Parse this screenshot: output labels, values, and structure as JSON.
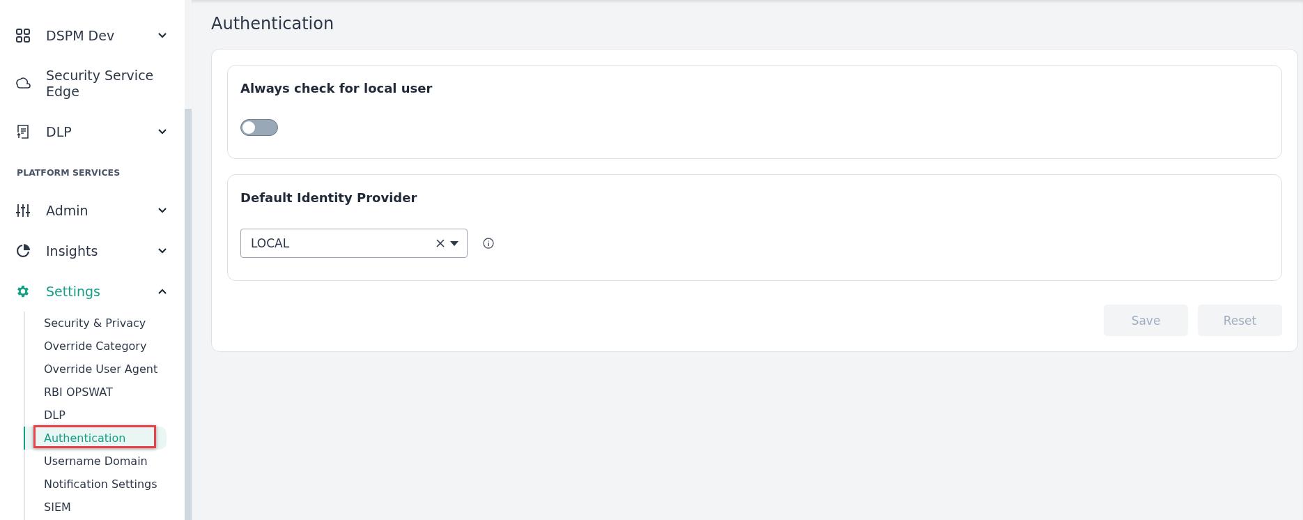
{
  "sidebar": {
    "sections": [
      {
        "items": [
          {
            "kind": "group",
            "label": "DSPM Dev",
            "expanded": false,
            "selected": false
          },
          {
            "kind": "link",
            "label": "Security Service Edge",
            "selected": false
          },
          {
            "kind": "group",
            "label": "DLP",
            "expanded": false,
            "selected": false
          }
        ]
      },
      {
        "heading": "PLATFORM SERVICES",
        "items": [
          {
            "kind": "group",
            "label": "Admin",
            "expanded": false,
            "selected": false
          },
          {
            "kind": "group",
            "label": "Insights",
            "expanded": false,
            "selected": false
          },
          {
            "kind": "group",
            "label": "Settings",
            "expanded": true,
            "selected": true,
            "children": [
              {
                "label": "Security & Privacy",
                "selected": false
              },
              {
                "label": "Override Category",
                "selected": false
              },
              {
                "label": "Override User Agent",
                "selected": false
              },
              {
                "label": "RBI OPSWAT",
                "selected": false
              },
              {
                "label": "DLP",
                "selected": false
              },
              {
                "label": "Authentication",
                "selected": true,
                "highlighted": true
              },
              {
                "label": "Username Domain",
                "selected": false
              },
              {
                "label": "Notification Settings",
                "selected": false
              },
              {
                "label": "SIEM",
                "selected": false
              }
            ]
          }
        ]
      }
    ]
  },
  "page": {
    "title": "Authentication",
    "local_user_check": {
      "title": "Always check for local user",
      "on": false
    },
    "identity_provider": {
      "title": "Default Identity Provider",
      "value": "LOCAL"
    },
    "buttons": [
      {
        "label": "Save",
        "disabled": true
      },
      {
        "label": "Reset",
        "disabled": true
      }
    ]
  }
}
